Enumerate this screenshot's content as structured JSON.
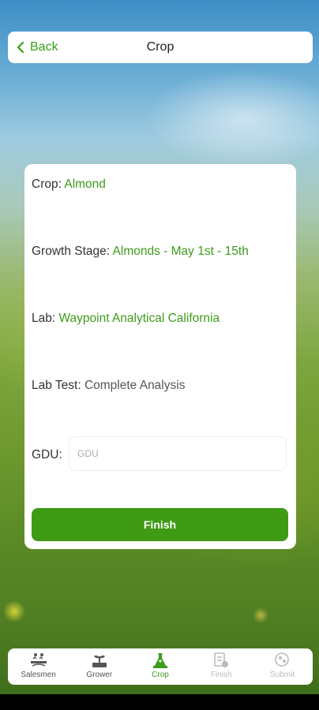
{
  "header": {
    "back_label": "Back",
    "title": "Crop"
  },
  "form": {
    "crop": {
      "label": "Crop:",
      "value": "Almond"
    },
    "growth_stage": {
      "label": "Growth Stage:",
      "value": "Almonds - May 1st - 15th"
    },
    "lab": {
      "label": "Lab:",
      "value": "Waypoint Analytical California"
    },
    "lab_test": {
      "label": "Lab Test:",
      "value": "Complete Analysis"
    },
    "gdu": {
      "label": "GDU:",
      "value": "",
      "placeholder": "GDU"
    },
    "finish_label": "Finish"
  },
  "tabs": [
    {
      "label": "Salesmen",
      "icon": "salesmen-icon",
      "state": "enabled"
    },
    {
      "label": "Grower",
      "icon": "grower-icon",
      "state": "enabled"
    },
    {
      "label": "Crop",
      "icon": "crop-icon",
      "state": "active"
    },
    {
      "label": "Finish",
      "icon": "finish-icon",
      "state": "disabled"
    },
    {
      "label": "Submit",
      "icon": "submit-icon",
      "state": "disabled"
    }
  ],
  "colors": {
    "accent_green": "#3d9b1a",
    "button_green": "#3f9a14"
  }
}
